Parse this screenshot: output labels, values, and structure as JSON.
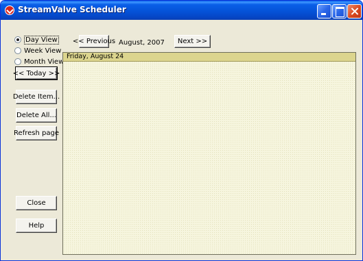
{
  "window": {
    "title": "StreamValve Scheduler"
  },
  "view_options": [
    {
      "label": "Day View",
      "selected": true
    },
    {
      "label": "Week View",
      "selected": false
    },
    {
      "label": "Month View",
      "selected": false
    }
  ],
  "sidebar": {
    "today_label": "<< Today >>",
    "delete_item_label": "Delete Item...",
    "delete_all_label": "Delete All...",
    "refresh_label": "Refresh page",
    "close_label": "Close",
    "help_label": "Help"
  },
  "nav": {
    "previous_label": "<< Previous",
    "month_label": "August, 2007",
    "next_label": "Next >>"
  },
  "calendar": {
    "day_header": "Friday, August 24"
  },
  "colors": {
    "titlebar": "#0a5fe8",
    "header_bar": "#dcd58e",
    "panel_bg": "#f6f5de",
    "window_bg": "#ece9d8"
  }
}
